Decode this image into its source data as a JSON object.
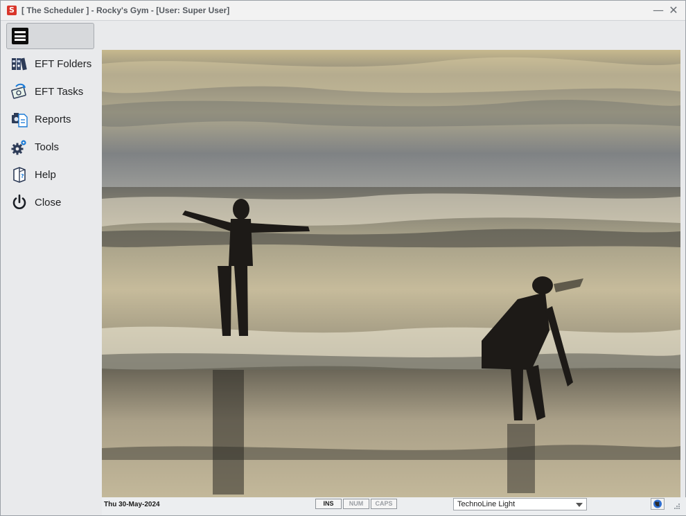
{
  "window": {
    "app_icon_letter": "S",
    "title": "[ The Scheduler ] - Rocky's Gym - [User: Super User]",
    "minimize_glyph": "—",
    "close_glyph": "✕"
  },
  "sidebar": {
    "menu_button_icon": "hamburger-icon",
    "items": [
      {
        "label": "EFT Folders",
        "icon": "binders-icon"
      },
      {
        "label": "EFT Tasks",
        "icon": "money-task-icon"
      },
      {
        "label": "Reports",
        "icon": "reports-icon"
      },
      {
        "label": "Tools",
        "icon": "gears-icon"
      },
      {
        "label": "Help",
        "icon": "help-book-icon"
      },
      {
        "label": "Close",
        "icon": "power-icon"
      }
    ]
  },
  "background_image": {
    "subject": "beach photo"
  },
  "statusbar": {
    "date": "Thu  30-May-2024",
    "ins": "INS",
    "num": "NUM",
    "caps": "CAPS",
    "theme": "TechnoLine Light",
    "globe_icon": "globe-icon"
  },
  "colors": {
    "accent_blue": "#1a7ad6",
    "app_red": "#d9362b"
  }
}
